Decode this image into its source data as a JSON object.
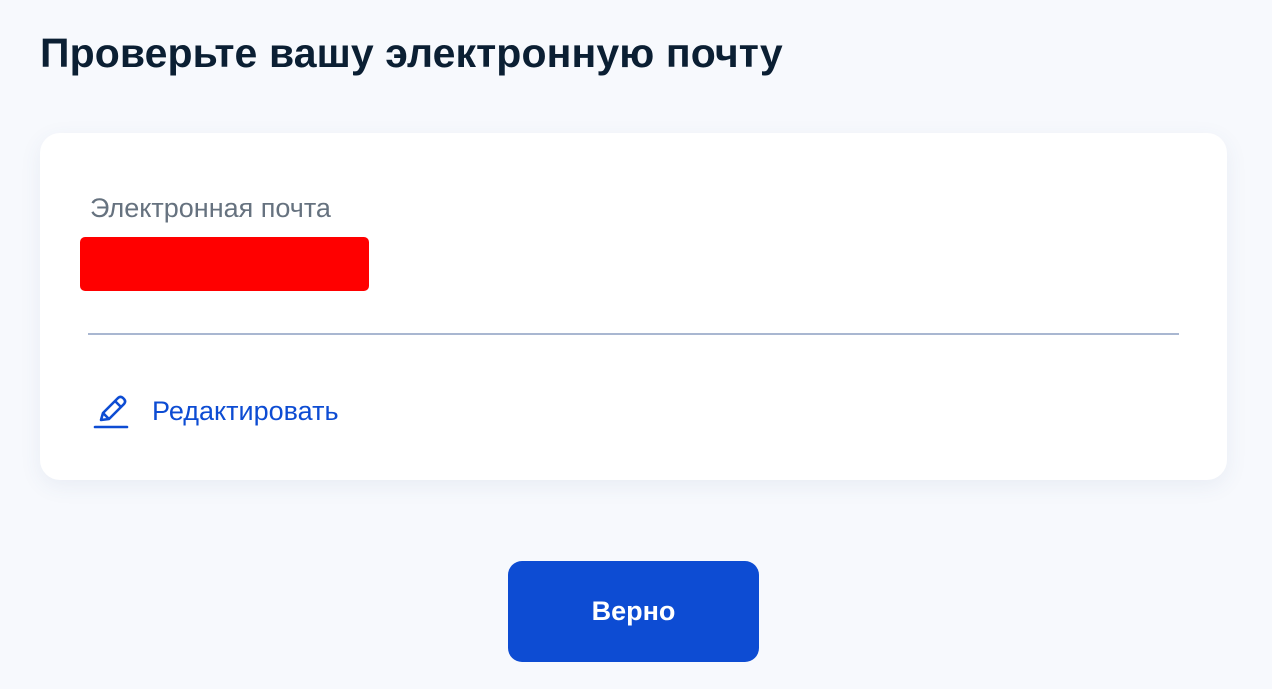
{
  "page": {
    "title": "Проверьте вашу электронную почту"
  },
  "email_card": {
    "label": "Электронная почта",
    "value": "",
    "value_redacted": true,
    "edit_label": "Редактировать",
    "edit_icon": "pencil-icon"
  },
  "actions": {
    "confirm_label": "Верно"
  },
  "colors": {
    "background": "#f7f9fd",
    "card": "#ffffff",
    "title_text": "#0b1f33",
    "label_text": "#66727f",
    "accent": "#0d4cd3",
    "divider": "#a9b7d1",
    "redaction": "#ff0000"
  }
}
